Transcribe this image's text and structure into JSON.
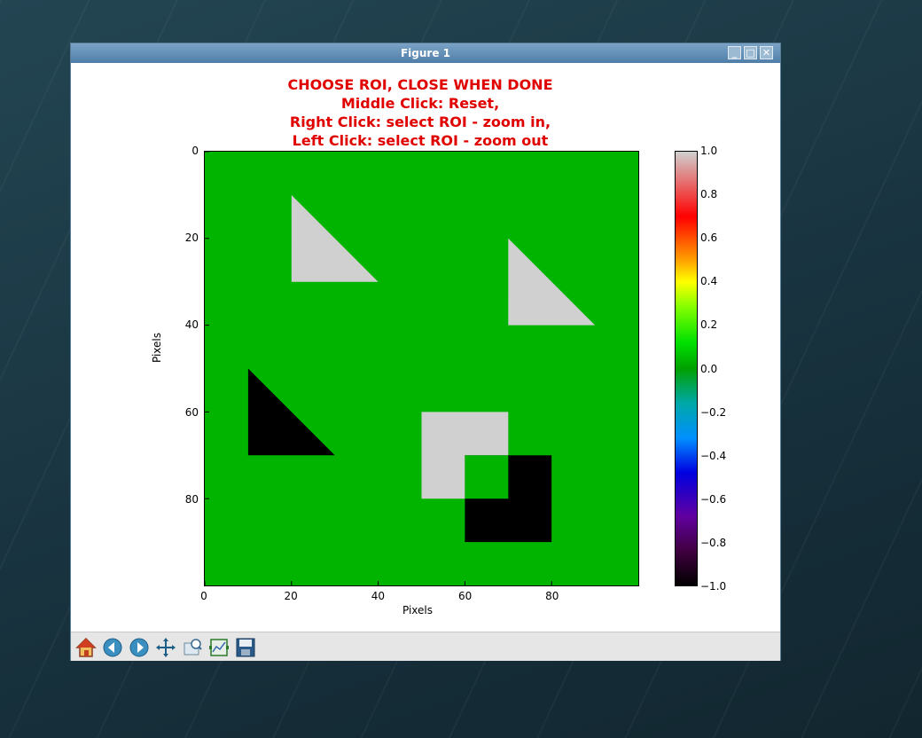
{
  "window": {
    "title": "Figure 1",
    "controls": [
      "minimize",
      "maximize",
      "close"
    ]
  },
  "figure": {
    "title_lines": [
      "CHOOSE ROI, CLOSE WHEN DONE",
      "Middle Click: Reset,",
      "Right Click: select ROI - zoom in,",
      "Left Click: select ROI - zoom out"
    ],
    "title_color": "#e00000"
  },
  "chart_data": {
    "type": "heatmap",
    "xlabel": "Pixels",
    "ylabel": "Pixels",
    "xlim": [
      0,
      100
    ],
    "ylim": [
      100,
      0
    ],
    "x_ticks": [
      0,
      20,
      40,
      60,
      80
    ],
    "y_ticks": [
      0,
      20,
      40,
      60,
      80
    ],
    "background_value": 0.0,
    "colormap": "spectral",
    "shapes": [
      {
        "shape": "triangle",
        "value": 1.0,
        "points": [
          [
            20,
            10
          ],
          [
            20,
            30
          ],
          [
            40,
            30
          ]
        ]
      },
      {
        "shape": "triangle",
        "value": 1.0,
        "points": [
          [
            70,
            20
          ],
          [
            70,
            40
          ],
          [
            90,
            40
          ]
        ]
      },
      {
        "shape": "triangle",
        "value": -1.0,
        "points": [
          [
            10,
            50
          ],
          [
            10,
            70
          ],
          [
            30,
            70
          ]
        ]
      },
      {
        "shape": "rect",
        "value": 1.0,
        "x": [
          50,
          70
        ],
        "y": [
          60,
          80
        ]
      },
      {
        "shape": "rect",
        "value": -1.0,
        "x": [
          60,
          80
        ],
        "y": [
          70,
          90
        ]
      },
      {
        "shape": "rect",
        "value": 0.0,
        "x": [
          60,
          70
        ],
        "y": [
          70,
          80
        ]
      }
    ],
    "value_colors": {
      "1.0": "#d0d0d0",
      "0.0": "#00b400",
      "-1.0": "#000000"
    },
    "colorbar": {
      "range": [
        -1.0,
        1.0
      ],
      "ticks": [
        "1.0",
        "0.8",
        "0.6",
        "0.4",
        "0.2",
        "0.0",
        "−0.2",
        "−0.4",
        "−0.6",
        "−0.8",
        "−1.0"
      ]
    }
  },
  "toolbar": {
    "tools": [
      {
        "name": "home-icon",
        "tooltip": "Reset original view"
      },
      {
        "name": "back-icon",
        "tooltip": "Back"
      },
      {
        "name": "forward-icon",
        "tooltip": "Forward"
      },
      {
        "name": "pan-icon",
        "tooltip": "Pan"
      },
      {
        "name": "zoom-icon",
        "tooltip": "Zoom"
      },
      {
        "name": "subplots-icon",
        "tooltip": "Configure subplots"
      },
      {
        "name": "save-icon",
        "tooltip": "Save"
      }
    ]
  }
}
